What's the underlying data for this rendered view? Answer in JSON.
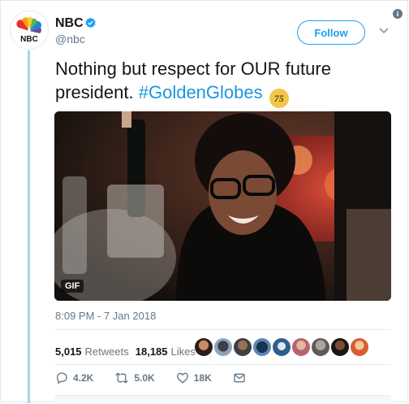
{
  "tweet": {
    "display_name": "NBC",
    "handle": "@nbc",
    "follow_label": "Follow",
    "text_plain": "Nothing but respect for OUR future president. ",
    "hashtag": "#GoldenGlobes",
    "badge_text": "75",
    "media_badge": "GIF",
    "timestamp": "8:09 PM - 7 Jan 2018"
  },
  "stats": {
    "retweets_count": "5,015",
    "retweets_label": "Retweets",
    "likes_count": "18,185",
    "likes_label": "Likes"
  },
  "actions": {
    "reply_count": "4.2K",
    "retweet_count": "5.0K",
    "like_count": "18K"
  },
  "colors": {
    "accent": "#1da1f2",
    "hashtag": "#1b95e0",
    "muted": "#657786",
    "thread_line": "#a8d4e6"
  },
  "icons": [
    "info-icon",
    "nbc-peacock-logo",
    "verified-icon",
    "chevron-down-icon",
    "reply-icon",
    "retweet-icon",
    "like-icon",
    "dm-icon"
  ],
  "avatars_liked_count": 9
}
